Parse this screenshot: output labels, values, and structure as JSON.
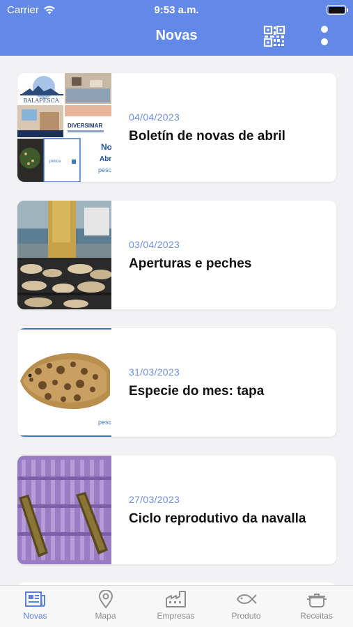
{
  "status": {
    "carrier": "Carrier",
    "time": "9:53 a.m."
  },
  "header": {
    "title": "Novas",
    "qr_icon": "qr-code-icon",
    "more_icon": "more-vertical-icon",
    "color": "#6288e8"
  },
  "thumb_texts": {
    "abril_brand": "BALAPESCA",
    "abril_diversimar": "DIVERSIMAR",
    "abril_snippet": "No",
    "abril_snippet2": "Abr",
    "abril_pesca": "pesca",
    "tapa_pesca": "pesc"
  },
  "news": [
    {
      "date": "04/04/2023",
      "title": "Boletín de novas de abril"
    },
    {
      "date": "03/04/2023",
      "title": "Aperturas e peches"
    },
    {
      "date": "31/03/2023",
      "title": "Especie do mes: tapa"
    },
    {
      "date": "27/03/2023",
      "title": "Ciclo reprodutivo da navalla"
    }
  ],
  "tabs": [
    {
      "label": "Novas",
      "icon": "newspaper-icon",
      "active": true
    },
    {
      "label": "Mapa",
      "icon": "map-pin-icon",
      "active": false
    },
    {
      "label": "Empresas",
      "icon": "factory-icon",
      "active": false
    },
    {
      "label": "Produto",
      "icon": "fish-icon",
      "active": false
    },
    {
      "label": "Receitas",
      "icon": "cooking-pot-icon",
      "active": false
    }
  ],
  "colors": {
    "accent": "#5a80e0",
    "date": "#6f8fdc",
    "inactive": "#8e8e93"
  }
}
